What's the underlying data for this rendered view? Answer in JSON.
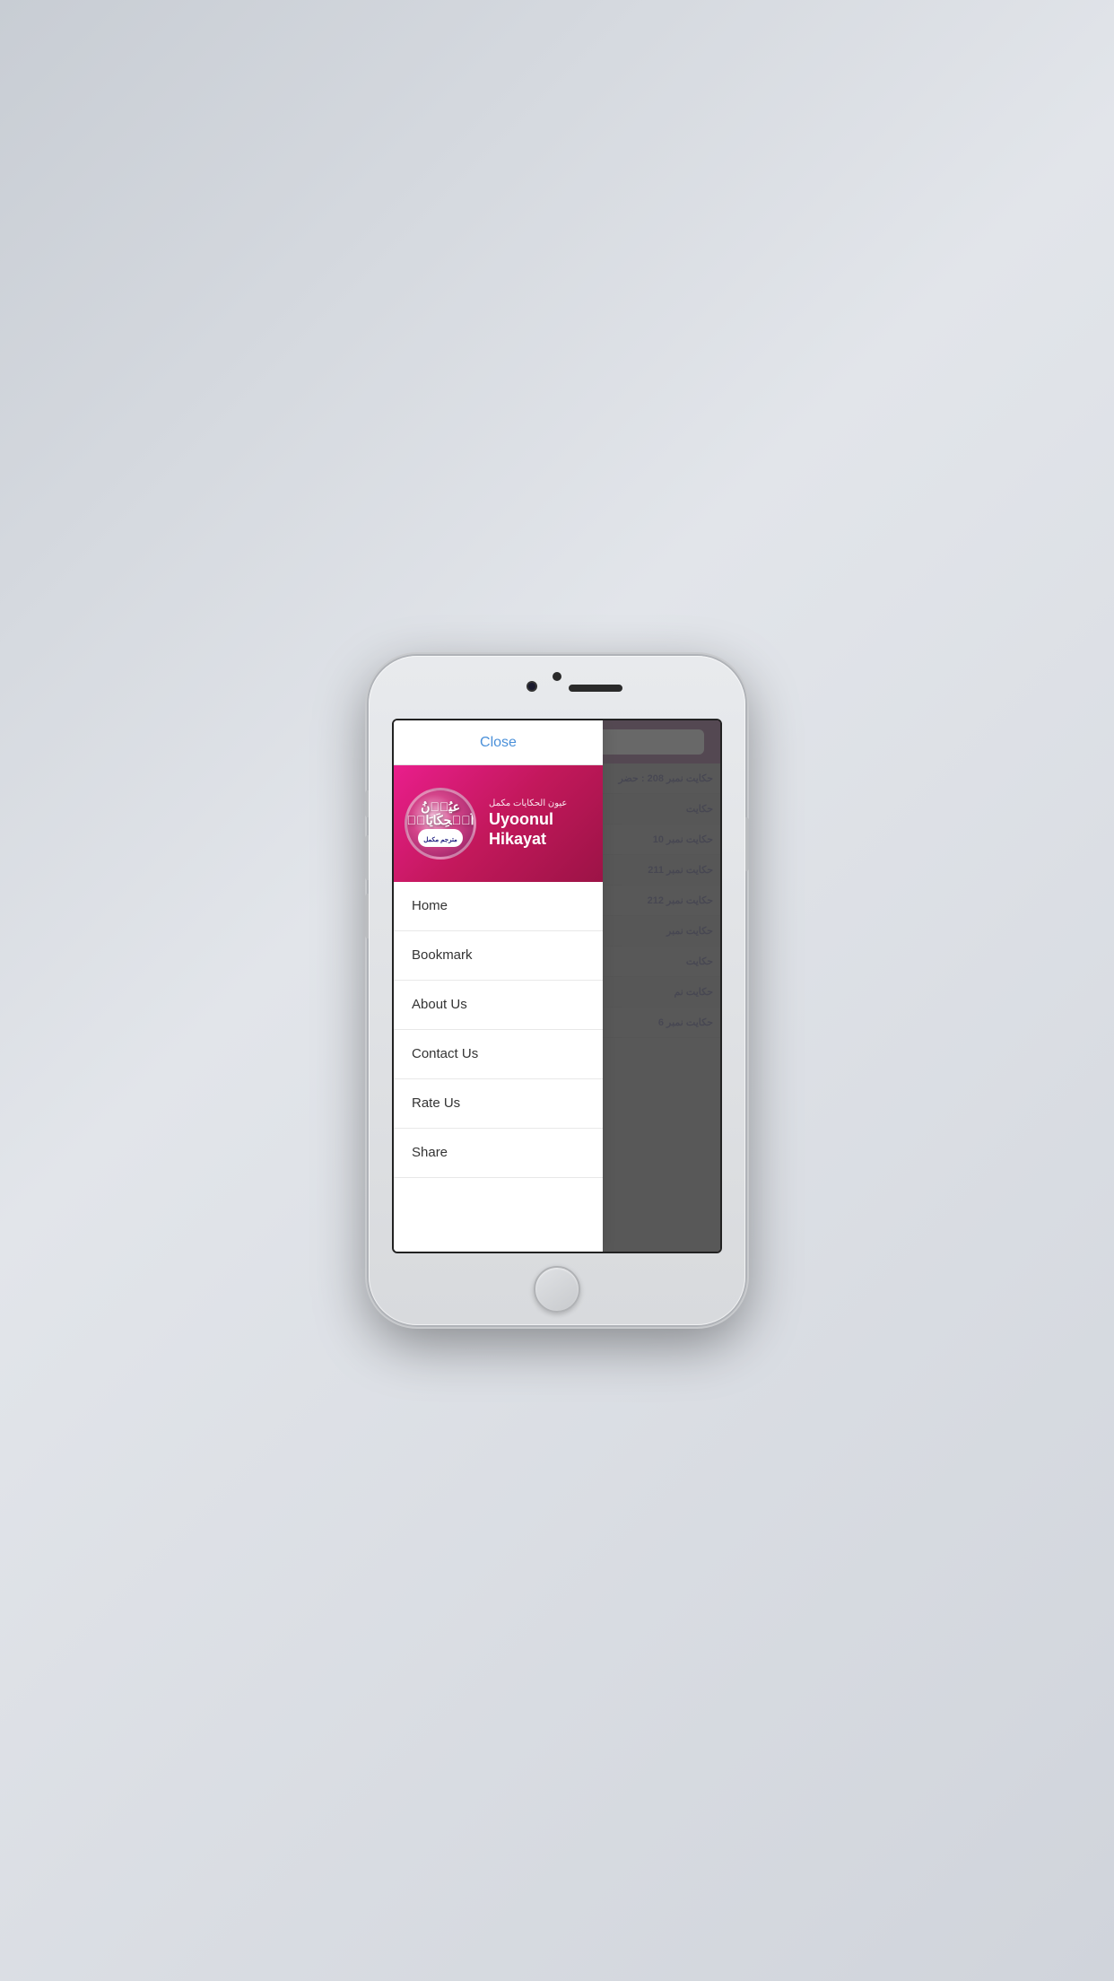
{
  "app": {
    "title_en": "Uyoonul\nHikayat",
    "title_urdu": "عیون الحکایات مکمل",
    "logo_text_line1": "عیُوۡنُ",
    "logo_text_line2": "اَلۡحِکَایَاتٖ",
    "logo_badge": "مترجم مکمل"
  },
  "header": {
    "close_label": "Close"
  },
  "menu": {
    "items": [
      {
        "label": "Home",
        "id": "home"
      },
      {
        "label": "Bookmark",
        "id": "bookmark"
      },
      {
        "label": "About Us",
        "id": "about-us"
      },
      {
        "label": "Contact Us",
        "id": "contact-us"
      },
      {
        "label": "Rate Us",
        "id": "rate-us"
      },
      {
        "label": "Share",
        "id": "share"
      }
    ]
  },
  "bg_list": {
    "items": [
      {
        "urdu": "حکایت نمبر 208 : حضر"
      },
      {
        "urdu": "حکایت"
      },
      {
        "urdu": "حکایت نمبر 10"
      },
      {
        "urdu": "حکایت نمبر 211"
      },
      {
        "urdu": "حکایت نمبر 212"
      },
      {
        "urdu": "حکایت نمبر"
      },
      {
        "urdu": "حکایت"
      },
      {
        "urdu": "حکایت نم"
      },
      {
        "urdu": "حکایت نمبر 6"
      }
    ]
  }
}
